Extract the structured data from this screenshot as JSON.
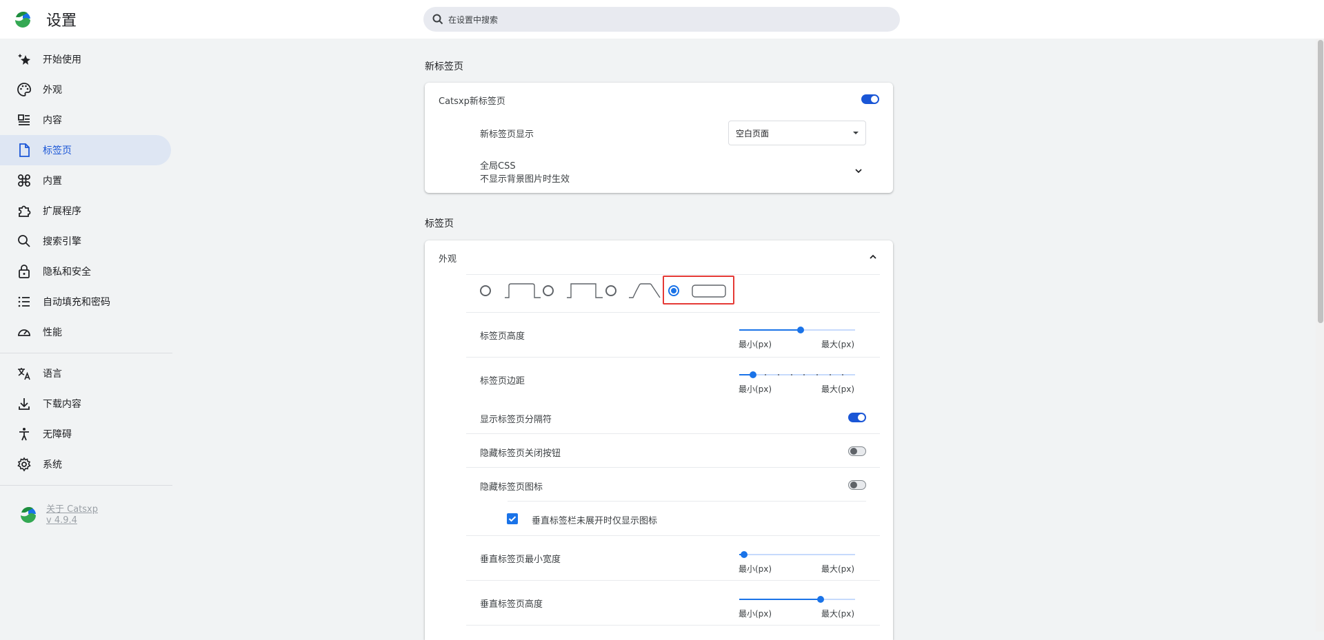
{
  "header": {
    "title": "设置",
    "search_placeholder": "在设置中搜索"
  },
  "sidebar": {
    "items": [
      {
        "label": "开始使用",
        "icon": "sparkle-star-icon"
      },
      {
        "label": "外观",
        "icon": "palette-icon"
      },
      {
        "label": "内容",
        "icon": "content-list-icon"
      },
      {
        "label": "标签页",
        "icon": "document-icon",
        "active": true
      },
      {
        "label": "内置",
        "icon": "command-icon"
      },
      {
        "label": "扩展程序",
        "icon": "puzzle-icon"
      },
      {
        "label": "搜索引擎",
        "icon": "search-icon"
      },
      {
        "label": "隐私和安全",
        "icon": "lock-icon"
      },
      {
        "label": "自动填充和密码",
        "icon": "list-icon"
      },
      {
        "label": "性能",
        "icon": "gauge-icon"
      },
      {
        "label": "语言",
        "icon": "translate-icon"
      },
      {
        "label": "下载内容",
        "icon": "download-icon"
      },
      {
        "label": "无障碍",
        "icon": "accessibility-icon"
      },
      {
        "label": "系统",
        "icon": "gear-icon"
      }
    ],
    "about": {
      "name": "关于 Catsxp",
      "version": "v 4.9.4"
    }
  },
  "newtab": {
    "section_title": "新标签页",
    "catsxp_newtab_label": "Catsxp新标签页",
    "catsxp_newtab_enabled": true,
    "display_label": "新标签页显示",
    "display_value": "空白页面",
    "global_css_label": "全局CSS",
    "global_css_desc": "不显示背景图片时生效"
  },
  "tabs": {
    "section_title": "标签页",
    "appearance": {
      "label": "外观",
      "expanded": true,
      "tab_styles": [
        "style-1",
        "style-2",
        "style-3",
        "style-4"
      ],
      "selected_style_index": 3,
      "tab_height": {
        "label": "标签页高度",
        "min_label": "最小(px)",
        "max_label": "最大(px)",
        "value_fraction": 0.53
      },
      "tab_margin": {
        "label": "标签页边距",
        "min_label": "最小(px)",
        "max_label": "最大(px)",
        "value_fraction": 0.12
      },
      "show_separator": {
        "label": "显示标签页分隔符",
        "enabled": true
      },
      "hide_close_button": {
        "label": "隐藏标签页关闭按钮",
        "enabled": false
      },
      "hide_tab_icon": {
        "label": "隐藏标签页图标",
        "enabled": false
      },
      "vertical_icons_only": {
        "label": "垂直标签栏未展开时仅显示图标",
        "checked": true
      },
      "vertical_min_width": {
        "label": "垂直标签页最小宽度",
        "min_label": "最小(px)",
        "max_label": "最大(px)",
        "value_fraction": 0.04
      },
      "vertical_height": {
        "label": "垂直标签页高度",
        "min_label": "最小(px)",
        "max_label": "最大(px)",
        "value_fraction": 0.7
      }
    }
  },
  "colors": {
    "accent": "#1a73e8",
    "active_nav_bg": "#dee6f3",
    "highlight": "#e53935"
  }
}
